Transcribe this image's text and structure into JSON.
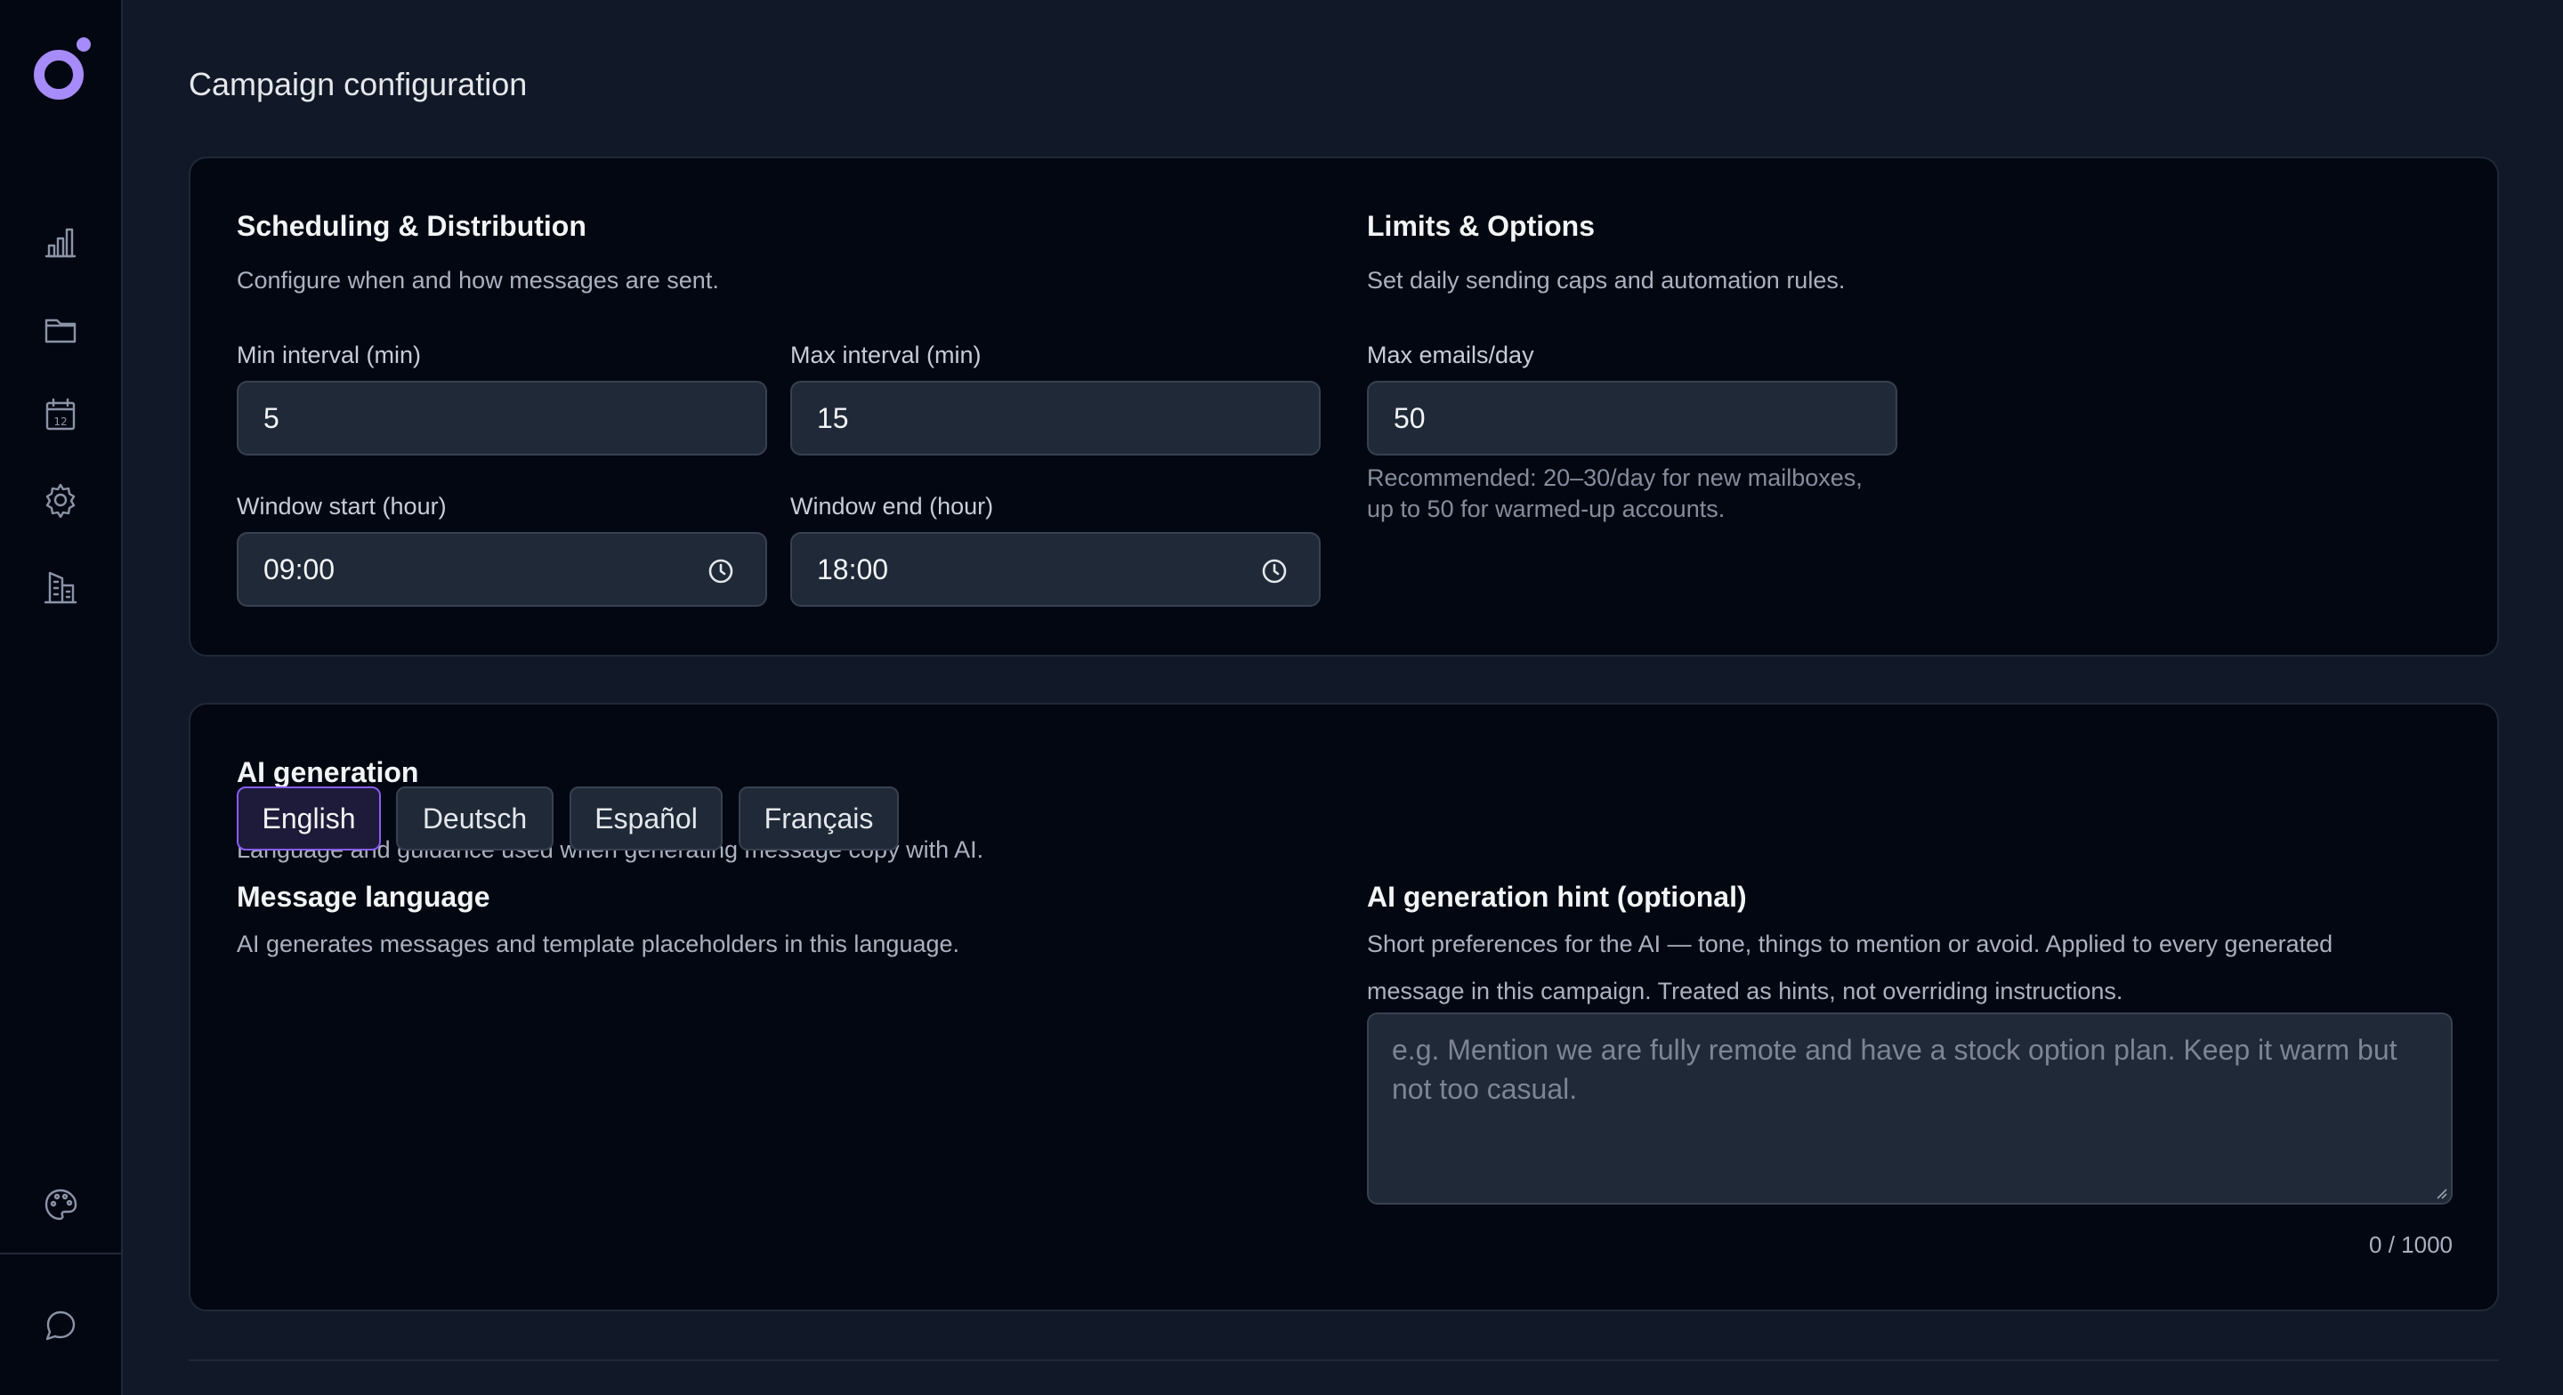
{
  "sidebar": {
    "logo_icon": "brand-logo-icon",
    "accent_color": "#8b5cf6",
    "items": [
      {
        "icon": "bar-chart-icon"
      },
      {
        "icon": "folder-icon"
      },
      {
        "icon": "calendar-icon",
        "day": "12"
      },
      {
        "icon": "gear-icon"
      },
      {
        "icon": "building-icon"
      }
    ],
    "bottom_items": [
      {
        "icon": "palette-icon"
      },
      {
        "icon": "chat-bubble-icon"
      }
    ]
  },
  "page": {
    "title": "Campaign configuration"
  },
  "scheduling": {
    "title": "Scheduling & Distribution",
    "description": "Configure when and how messages are sent.",
    "min_interval": {
      "label": "Min interval (min)",
      "value": "5"
    },
    "max_interval": {
      "label": "Max interval (min)",
      "value": "15"
    },
    "window_start": {
      "label": "Window start (hour)",
      "value": "09:00"
    },
    "window_end": {
      "label": "Window end (hour)",
      "value": "18:00"
    }
  },
  "limits": {
    "title": "Limits & Options",
    "description": "Set daily sending caps and automation rules.",
    "max_emails": {
      "label": "Max emails/day",
      "value": "50"
    },
    "hint_line1": "Recommended: 20–30/day for new mailboxes,",
    "hint_line2": "up to 50 for warmed-up accounts."
  },
  "ai": {
    "title": "AI generation",
    "description": "Language and guidance used when generating message copy with AI.",
    "language": {
      "title": "Message language",
      "description": "AI generates messages and template placeholders in this language.",
      "options": [
        "English",
        "Deutsch",
        "Español",
        "Français"
      ],
      "selected": "English"
    },
    "hint": {
      "title": "AI generation hint (optional)",
      "description_line1": "Short preferences for the AI — tone, things to mention or avoid. Applied to every generated",
      "description_line2": "message in this campaign. Treated as hints, not overriding instructions.",
      "placeholder": "e.g. Mention we are fully remote and have a stock option plan. Keep it warm but not too casual.",
      "counter": "0 / 1000"
    }
  }
}
